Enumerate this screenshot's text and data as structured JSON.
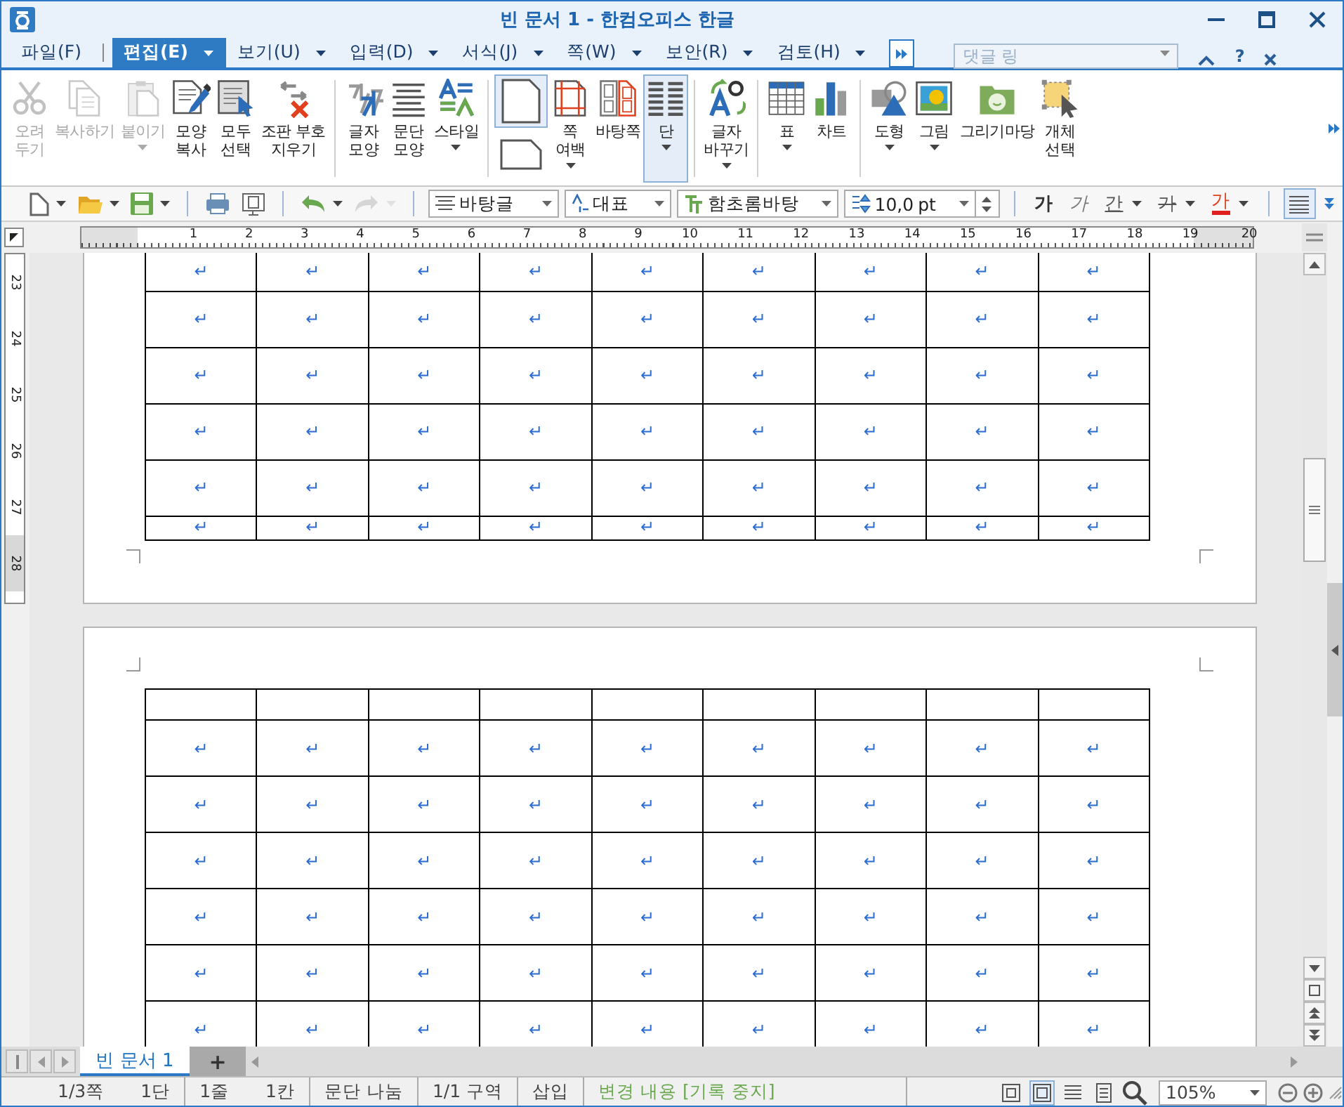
{
  "window": {
    "title": "빈 문서 1 - 한컴오피스 한글",
    "help_label": "?"
  },
  "menu_tabs": [
    {
      "label": "파일(F)",
      "selected": false,
      "dropdown": false
    },
    {
      "label": "편집(E)",
      "selected": true,
      "dropdown": true
    },
    {
      "label": "보기(U)",
      "selected": false,
      "dropdown": true
    },
    {
      "label": "입력(D)",
      "selected": false,
      "dropdown": true
    },
    {
      "label": "서식(J)",
      "selected": false,
      "dropdown": true
    },
    {
      "label": "쪽(W)",
      "selected": false,
      "dropdown": true
    },
    {
      "label": "보안(R)",
      "selected": false,
      "dropdown": true
    },
    {
      "label": "검토(H)",
      "selected": false,
      "dropdown": true
    }
  ],
  "comment_search": {
    "placeholder": "댓글 링"
  },
  "ribbon": {
    "groups": [
      [
        {
          "kind": "large",
          "lines": [
            "오려",
            "두기"
          ],
          "disabled": true,
          "dropdown": false,
          "selected": false
        },
        {
          "kind": "large",
          "lines": [
            "복사하기"
          ],
          "disabled": true,
          "dropdown": false,
          "selected": false
        },
        {
          "kind": "large",
          "lines": [
            "붙이기"
          ],
          "disabled": true,
          "dropdown": true,
          "selected": false
        },
        {
          "kind": "large",
          "lines": [
            "모양",
            "복사"
          ],
          "disabled": false,
          "dropdown": false,
          "selected": false
        },
        {
          "kind": "large",
          "lines": [
            "모두",
            "선택"
          ],
          "disabled": false,
          "dropdown": false,
          "selected": false
        },
        {
          "kind": "large",
          "lines": [
            "조판 부호",
            "지우기"
          ],
          "disabled": false,
          "dropdown": false,
          "selected": false
        }
      ],
      [
        {
          "kind": "large",
          "lines": [
            "글자",
            "모양"
          ],
          "disabled": false,
          "dropdown": false,
          "selected": false
        },
        {
          "kind": "large",
          "lines": [
            "문단",
            "모양"
          ],
          "disabled": false,
          "dropdown": false,
          "selected": false
        },
        {
          "kind": "large",
          "lines": [
            "스타일"
          ],
          "disabled": false,
          "dropdown": true,
          "selected": false
        }
      ],
      [
        {
          "kind": "pair",
          "buttons": [
            {
              "selected": true
            },
            {
              "selected": false
            }
          ]
        },
        {
          "kind": "large",
          "lines": [
            "쪽",
            "여백"
          ],
          "disabled": false,
          "dropdown": true,
          "selected": false
        },
        {
          "kind": "large",
          "lines": [
            "바탕쪽"
          ],
          "disabled": false,
          "dropdown": false,
          "selected": false
        },
        {
          "kind": "large",
          "lines": [
            "단"
          ],
          "disabled": false,
          "dropdown": true,
          "selected": true
        }
      ],
      [
        {
          "kind": "large",
          "lines": [
            "글자",
            "바꾸기"
          ],
          "disabled": false,
          "dropdown": true,
          "selected": false
        }
      ],
      [
        {
          "kind": "large",
          "lines": [
            "표"
          ],
          "disabled": false,
          "dropdown": true,
          "selected": false
        },
        {
          "kind": "large",
          "lines": [
            "차트"
          ],
          "disabled": false,
          "dropdown": false,
          "selected": false
        }
      ],
      [
        {
          "kind": "large",
          "lines": [
            "도형"
          ],
          "disabled": false,
          "dropdown": true,
          "selected": false
        },
        {
          "kind": "large",
          "lines": [
            "그림"
          ],
          "disabled": false,
          "dropdown": true,
          "selected": false
        },
        {
          "kind": "large",
          "lines": [
            "그리기마당"
          ],
          "disabled": false,
          "dropdown": false,
          "selected": false
        },
        {
          "kind": "large",
          "lines": [
            "개체",
            "선택"
          ],
          "disabled": false,
          "dropdown": false,
          "selected": false
        }
      ]
    ]
  },
  "toolbar": {
    "redo_disabled": true,
    "style": "바탕글",
    "language": "대표",
    "font": "함초롬바탕",
    "size": "10,0",
    "unit": "pt",
    "formats": [
      {
        "kind": "bold",
        "label": "가",
        "dropdown": false
      },
      {
        "kind": "italic",
        "label": "가",
        "dropdown": false
      },
      {
        "kind": "underline",
        "label": "간",
        "dropdown": true
      },
      {
        "kind": "strike",
        "label": "가",
        "dropdown": true
      },
      {
        "kind": "color",
        "label": "가",
        "dropdown": true
      }
    ],
    "align_selected": true
  },
  "ruler": {
    "numbers": [
      "1",
      "2",
      "3",
      "4",
      "5",
      "6",
      "7",
      "8",
      "9",
      "10",
      "11",
      "12",
      "13",
      "14",
      "15",
      "16",
      "17",
      "18",
      "19",
      "20"
    ]
  },
  "vertical_ruler": {
    "numbers": [
      "23",
      "24",
      "25",
      "26",
      "27",
      "28"
    ]
  },
  "pages": [
    {
      "empty_first_row": false,
      "rows": [
        [
          "↵",
          "↵",
          "↵",
          "↵",
          "↵",
          "↵",
          "↵",
          "↵",
          "↵"
        ],
        [
          "↵",
          "↵",
          "↵",
          "↵",
          "↵",
          "↵",
          "↵",
          "↵",
          "↵"
        ],
        [
          "↵",
          "↵",
          "↵",
          "↵",
          "↵",
          "↵",
          "↵",
          "↵",
          "↵"
        ],
        [
          "↵",
          "↵",
          "↵",
          "↵",
          "↵",
          "↵",
          "↵",
          "↵",
          "↵"
        ],
        [
          "↵",
          "↵",
          "↵",
          "↵",
          "↵",
          "↵",
          "↵",
          "↵",
          "↵"
        ],
        [
          "↵",
          "↵",
          "↵",
          "↵",
          "↵",
          "↵",
          "↵",
          "↵",
          "↵"
        ]
      ]
    },
    {
      "empty_first_row": true,
      "rows": [
        [
          "↵",
          "↵",
          "↵",
          "↵",
          "↵",
          "↵",
          "↵",
          "↵",
          "↵"
        ],
        [
          "↵",
          "↵",
          "↵",
          "↵",
          "↵",
          "↵",
          "↵",
          "↵",
          "↵"
        ],
        [
          "↵",
          "↵",
          "↵",
          "↵",
          "↵",
          "↵",
          "↵",
          "↵",
          "↵"
        ],
        [
          "↵",
          "↵",
          "↵",
          "↵",
          "↵",
          "↵",
          "↵",
          "↵",
          "↵"
        ],
        [
          "↵",
          "↵",
          "↵",
          "↵",
          "↵",
          "↵",
          "↵",
          "↵",
          "↵"
        ],
        [
          "↵",
          "↵",
          "↵",
          "↵",
          "↵",
          "↵",
          "↵",
          "↵",
          "↵"
        ]
      ]
    }
  ],
  "doc_tabs": [
    {
      "label": "빈 문서 1",
      "selected": true
    }
  ],
  "add_tab_label": "+",
  "status_bar": {
    "sections": [
      [
        "1/3쪽",
        "1단"
      ],
      [
        "1줄",
        "1칸"
      ],
      [
        "문단 나눔"
      ],
      [
        "1/1 구역"
      ],
      [
        "삽입"
      ]
    ],
    "track_changes": "변경 내용 [기록 중지]",
    "views": [
      {
        "selected": false
      },
      {
        "selected": true
      },
      {
        "selected": false
      },
      {
        "selected": false
      }
    ],
    "zoom": "105%"
  }
}
